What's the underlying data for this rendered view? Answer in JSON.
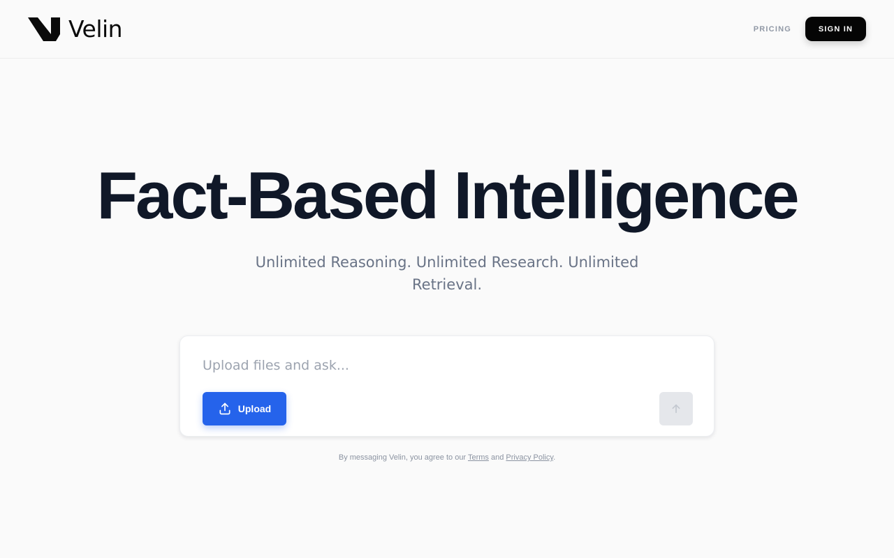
{
  "header": {
    "brand": "Velin",
    "logo_icon": "velin-v-logo-icon",
    "nav": {
      "pricing_label": "PRICING"
    },
    "signin_label": "SIGN IN"
  },
  "hero": {
    "title": "Fact-Based Intelligence",
    "subtitle": "Unlimited Reasoning. Unlimited Research. Unlimited Retrieval."
  },
  "composer": {
    "input_value": "",
    "placeholder": "Upload files and ask...",
    "upload_label": "Upload",
    "upload_icon": "upload-icon",
    "send_icon": "arrow-up-icon"
  },
  "footer": {
    "prefix": "By messaging Velin, you agree to our",
    "terms_label": "Terms",
    "and_text": "and",
    "privacy_label": "Privacy Policy",
    "suffix": "."
  },
  "colors": {
    "background": "#fafafa",
    "title": "#101828",
    "subtitle": "#697386",
    "primary": "#2563eb",
    "signin_bg": "#050505",
    "send_disabled": "#e5e7eb"
  }
}
